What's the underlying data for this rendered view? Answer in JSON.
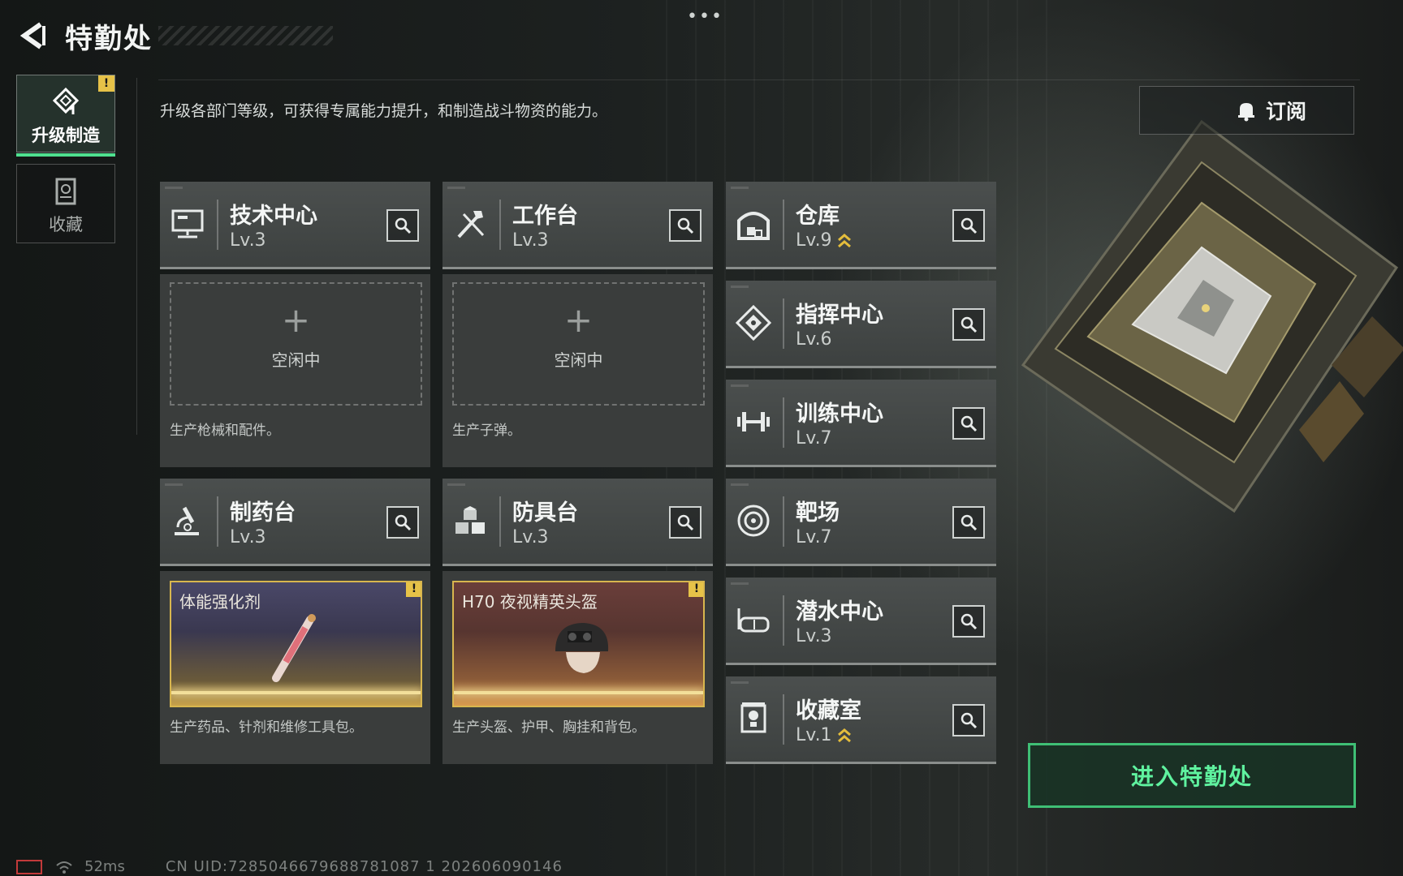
{
  "header": {
    "title": "特勤处",
    "description": "升级各部门等级，可获得专属能力提升，和制造战斗物资的能力。",
    "subscribe_label": "订阅"
  },
  "nav": {
    "tabs": [
      {
        "label": "升级制造",
        "active": true,
        "alert": "!"
      },
      {
        "label": "收藏",
        "active": false
      }
    ]
  },
  "workshops": [
    {
      "name": "技术中心",
      "level": "Lv.3",
      "status": "空闲中",
      "description": "生产枪械和配件。"
    },
    {
      "name": "工作台",
      "level": "Lv.3",
      "status": "空闲中",
      "description": "生产子弹。"
    },
    {
      "name": "制药台",
      "level": "Lv.3",
      "product": "体能强化剂",
      "alert": "!",
      "description": "生产药品、针剂和维修工具包。"
    },
    {
      "name": "防具台",
      "level": "Lv.3",
      "product": "H70 夜视精英头盔",
      "alert": "!",
      "description": "生产头盔、护甲、胸挂和背包。"
    }
  ],
  "facilities": [
    {
      "name": "仓库",
      "level": "Lv.9",
      "upgradable": true,
      "icon": "warehouse-icon"
    },
    {
      "name": "指挥中心",
      "level": "Lv.6",
      "upgradable": false,
      "icon": "command-icon"
    },
    {
      "name": "训练中心",
      "level": "Lv.7",
      "upgradable": false,
      "icon": "dumbbell-icon"
    },
    {
      "name": "靶场",
      "level": "Lv.7",
      "upgradable": false,
      "icon": "target-icon"
    },
    {
      "name": "潜水中心",
      "level": "Lv.3",
      "upgradable": false,
      "icon": "diving-mask-icon"
    },
    {
      "name": "收藏室",
      "level": "Lv.1",
      "upgradable": true,
      "icon": "display-case-icon"
    }
  ],
  "enter_button": "进入特勤处",
  "footer": {
    "ping": "52ms",
    "uid": "CN UID:7285046679688781087 1 202606090146"
  },
  "colors": {
    "accent_green": "#4fe08f",
    "alert_yellow": "#e6c248",
    "upgrade_gold": "#e4bd3c"
  }
}
